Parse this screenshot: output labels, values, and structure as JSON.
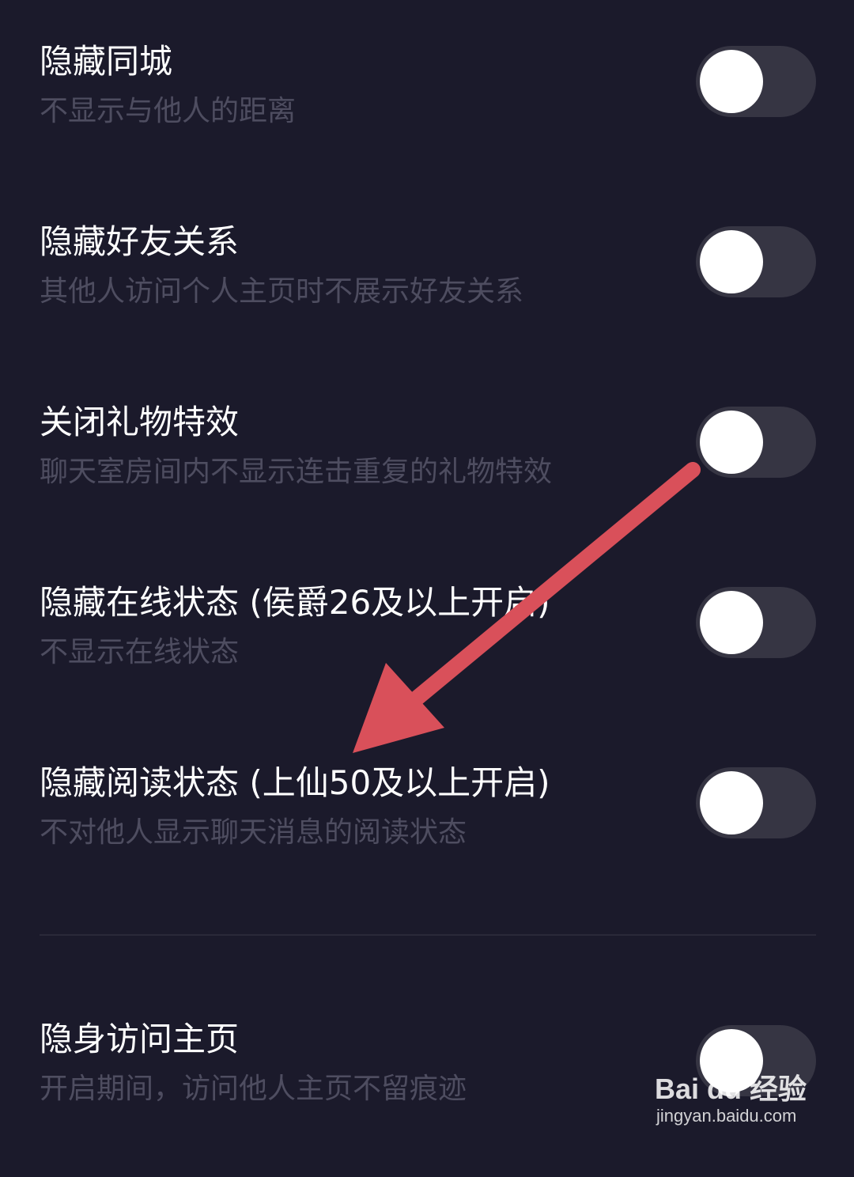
{
  "settings": [
    {
      "title": "隐藏同城",
      "description": "不显示与他人的距离",
      "enabled": false
    },
    {
      "title": "隐藏好友关系",
      "description": "其他人访问个人主页时不展示好友关系",
      "enabled": false
    },
    {
      "title": "关闭礼物特效",
      "description": "聊天室房间内不显示连击重复的礼物特效",
      "enabled": false
    },
    {
      "title": "隐藏在线状态 (侯爵26及以上开启)",
      "description": "不显示在线状态",
      "enabled": false
    },
    {
      "title": "隐藏阅读状态 (上仙50及以上开启)",
      "description": "不对他人显示聊天消息的阅读状态",
      "enabled": false
    },
    {
      "title": "隐身访问主页",
      "description": "开启期间，访问他人主页不留痕迹",
      "enabled": false
    }
  ],
  "annotation": {
    "icon": "red-arrow-icon",
    "color": "#d9505a"
  },
  "watermark": {
    "brand": "Bai du 经验",
    "url": "jingyan.baidu.com"
  },
  "colors": {
    "background": "#1b1a2b",
    "title": "#ffffff",
    "description": "#4e4d60",
    "toggle_track": "#363543",
    "toggle_knob": "#ffffff"
  }
}
